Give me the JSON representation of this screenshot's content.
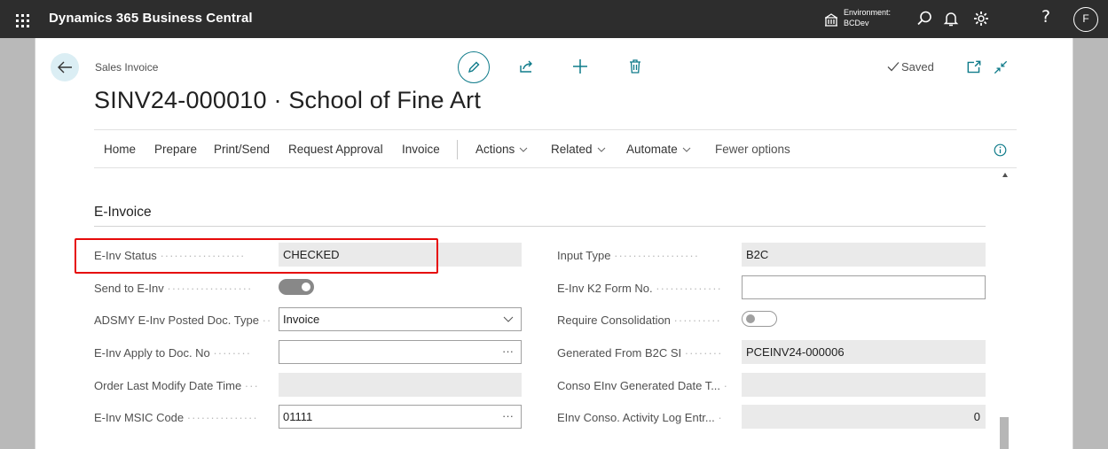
{
  "app": {
    "title": "Dynamics 365 Business Central",
    "environment_label": "Environment:",
    "environment_value": "BCDev",
    "user_initial": "F",
    "help_label": "?"
  },
  "page": {
    "caption": "Sales Invoice",
    "title": "SINV24-000010 · School of Fine Art",
    "saved_label": "Saved"
  },
  "actionbar": {
    "items": [
      "Home",
      "Prepare",
      "Print/Send",
      "Request Approval",
      "Invoice"
    ],
    "menus": [
      "Actions",
      "Related",
      "Automate"
    ],
    "fewer_options": "Fewer options"
  },
  "section": {
    "title": "E-Invoice"
  },
  "fields_left": {
    "einv_status": {
      "label": "E-Inv Status",
      "value": "CHECKED"
    },
    "send_to_einv": {
      "label": "Send to E-Inv",
      "value": "on"
    },
    "posted_doc_type": {
      "label": "ADSMY E-Inv Posted Doc. Type",
      "value": "Invoice"
    },
    "apply_to_doc": {
      "label": "E-Inv Apply to Doc. No",
      "value": ""
    },
    "order_last_modify": {
      "label": "Order Last Modify Date Time",
      "value": ""
    },
    "msic_code": {
      "label": "E-Inv MSIC Code",
      "value": "01111"
    }
  },
  "fields_right": {
    "input_type": {
      "label": "Input Type",
      "value": "B2C"
    },
    "k2_form_no": {
      "label": "E-Inv K2 Form No.",
      "value": ""
    },
    "require_consolidation": {
      "label": "Require Consolidation",
      "value": "off"
    },
    "generated_from": {
      "label": "Generated From B2C SI",
      "value": "PCEINV24-000006"
    },
    "conso_generated_date": {
      "label": "Conso EInv Generated Date T...",
      "value": ""
    },
    "activity_log": {
      "label": "EInv Conso. Activity Log Entr...",
      "value": "0"
    }
  },
  "assist_button_glyph": "···",
  "colors": {
    "topbar": "#2d2d2d",
    "accent": "#0f7b8a",
    "highlight": "#e60a0a"
  }
}
